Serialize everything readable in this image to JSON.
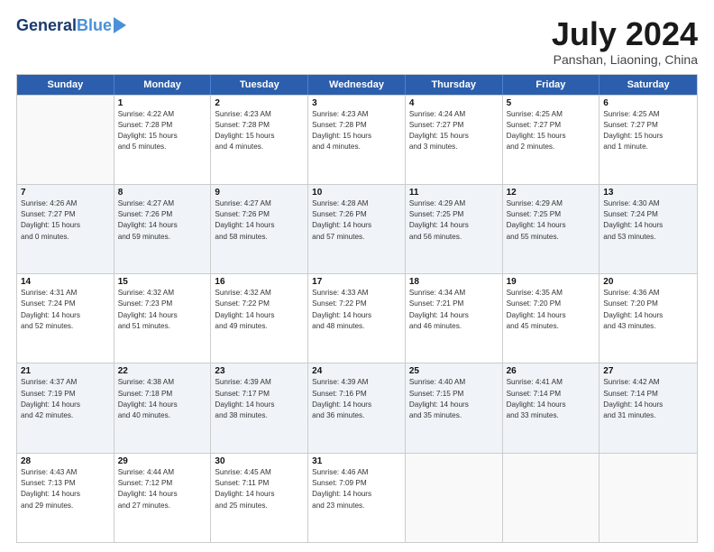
{
  "logo": {
    "general": "General",
    "blue": "Blue"
  },
  "title": "July 2024",
  "subtitle": "Panshan, Liaoning, China",
  "days": [
    "Sunday",
    "Monday",
    "Tuesday",
    "Wednesday",
    "Thursday",
    "Friday",
    "Saturday"
  ],
  "rows": [
    [
      {
        "day": "",
        "lines": []
      },
      {
        "day": "1",
        "lines": [
          "Sunrise: 4:22 AM",
          "Sunset: 7:28 PM",
          "Daylight: 15 hours",
          "and 5 minutes."
        ]
      },
      {
        "day": "2",
        "lines": [
          "Sunrise: 4:23 AM",
          "Sunset: 7:28 PM",
          "Daylight: 15 hours",
          "and 4 minutes."
        ]
      },
      {
        "day": "3",
        "lines": [
          "Sunrise: 4:23 AM",
          "Sunset: 7:28 PM",
          "Daylight: 15 hours",
          "and 4 minutes."
        ]
      },
      {
        "day": "4",
        "lines": [
          "Sunrise: 4:24 AM",
          "Sunset: 7:27 PM",
          "Daylight: 15 hours",
          "and 3 minutes."
        ]
      },
      {
        "day": "5",
        "lines": [
          "Sunrise: 4:25 AM",
          "Sunset: 7:27 PM",
          "Daylight: 15 hours",
          "and 2 minutes."
        ]
      },
      {
        "day": "6",
        "lines": [
          "Sunrise: 4:25 AM",
          "Sunset: 7:27 PM",
          "Daylight: 15 hours",
          "and 1 minute."
        ]
      }
    ],
    [
      {
        "day": "7",
        "lines": [
          "Sunrise: 4:26 AM",
          "Sunset: 7:27 PM",
          "Daylight: 15 hours",
          "and 0 minutes."
        ]
      },
      {
        "day": "8",
        "lines": [
          "Sunrise: 4:27 AM",
          "Sunset: 7:26 PM",
          "Daylight: 14 hours",
          "and 59 minutes."
        ]
      },
      {
        "day": "9",
        "lines": [
          "Sunrise: 4:27 AM",
          "Sunset: 7:26 PM",
          "Daylight: 14 hours",
          "and 58 minutes."
        ]
      },
      {
        "day": "10",
        "lines": [
          "Sunrise: 4:28 AM",
          "Sunset: 7:26 PM",
          "Daylight: 14 hours",
          "and 57 minutes."
        ]
      },
      {
        "day": "11",
        "lines": [
          "Sunrise: 4:29 AM",
          "Sunset: 7:25 PM",
          "Daylight: 14 hours",
          "and 56 minutes."
        ]
      },
      {
        "day": "12",
        "lines": [
          "Sunrise: 4:29 AM",
          "Sunset: 7:25 PM",
          "Daylight: 14 hours",
          "and 55 minutes."
        ]
      },
      {
        "day": "13",
        "lines": [
          "Sunrise: 4:30 AM",
          "Sunset: 7:24 PM",
          "Daylight: 14 hours",
          "and 53 minutes."
        ]
      }
    ],
    [
      {
        "day": "14",
        "lines": [
          "Sunrise: 4:31 AM",
          "Sunset: 7:24 PM",
          "Daylight: 14 hours",
          "and 52 minutes."
        ]
      },
      {
        "day": "15",
        "lines": [
          "Sunrise: 4:32 AM",
          "Sunset: 7:23 PM",
          "Daylight: 14 hours",
          "and 51 minutes."
        ]
      },
      {
        "day": "16",
        "lines": [
          "Sunrise: 4:32 AM",
          "Sunset: 7:22 PM",
          "Daylight: 14 hours",
          "and 49 minutes."
        ]
      },
      {
        "day": "17",
        "lines": [
          "Sunrise: 4:33 AM",
          "Sunset: 7:22 PM",
          "Daylight: 14 hours",
          "and 48 minutes."
        ]
      },
      {
        "day": "18",
        "lines": [
          "Sunrise: 4:34 AM",
          "Sunset: 7:21 PM",
          "Daylight: 14 hours",
          "and 46 minutes."
        ]
      },
      {
        "day": "19",
        "lines": [
          "Sunrise: 4:35 AM",
          "Sunset: 7:20 PM",
          "Daylight: 14 hours",
          "and 45 minutes."
        ]
      },
      {
        "day": "20",
        "lines": [
          "Sunrise: 4:36 AM",
          "Sunset: 7:20 PM",
          "Daylight: 14 hours",
          "and 43 minutes."
        ]
      }
    ],
    [
      {
        "day": "21",
        "lines": [
          "Sunrise: 4:37 AM",
          "Sunset: 7:19 PM",
          "Daylight: 14 hours",
          "and 42 minutes."
        ]
      },
      {
        "day": "22",
        "lines": [
          "Sunrise: 4:38 AM",
          "Sunset: 7:18 PM",
          "Daylight: 14 hours",
          "and 40 minutes."
        ]
      },
      {
        "day": "23",
        "lines": [
          "Sunrise: 4:39 AM",
          "Sunset: 7:17 PM",
          "Daylight: 14 hours",
          "and 38 minutes."
        ]
      },
      {
        "day": "24",
        "lines": [
          "Sunrise: 4:39 AM",
          "Sunset: 7:16 PM",
          "Daylight: 14 hours",
          "and 36 minutes."
        ]
      },
      {
        "day": "25",
        "lines": [
          "Sunrise: 4:40 AM",
          "Sunset: 7:15 PM",
          "Daylight: 14 hours",
          "and 35 minutes."
        ]
      },
      {
        "day": "26",
        "lines": [
          "Sunrise: 4:41 AM",
          "Sunset: 7:14 PM",
          "Daylight: 14 hours",
          "and 33 minutes."
        ]
      },
      {
        "day": "27",
        "lines": [
          "Sunrise: 4:42 AM",
          "Sunset: 7:14 PM",
          "Daylight: 14 hours",
          "and 31 minutes."
        ]
      }
    ],
    [
      {
        "day": "28",
        "lines": [
          "Sunrise: 4:43 AM",
          "Sunset: 7:13 PM",
          "Daylight: 14 hours",
          "and 29 minutes."
        ]
      },
      {
        "day": "29",
        "lines": [
          "Sunrise: 4:44 AM",
          "Sunset: 7:12 PM",
          "Daylight: 14 hours",
          "and 27 minutes."
        ]
      },
      {
        "day": "30",
        "lines": [
          "Sunrise: 4:45 AM",
          "Sunset: 7:11 PM",
          "Daylight: 14 hours",
          "and 25 minutes."
        ]
      },
      {
        "day": "31",
        "lines": [
          "Sunrise: 4:46 AM",
          "Sunset: 7:09 PM",
          "Daylight: 14 hours",
          "and 23 minutes."
        ]
      },
      {
        "day": "",
        "lines": []
      },
      {
        "day": "",
        "lines": []
      },
      {
        "day": "",
        "lines": []
      }
    ]
  ],
  "row_alt": [
    false,
    true,
    false,
    true,
    false
  ]
}
